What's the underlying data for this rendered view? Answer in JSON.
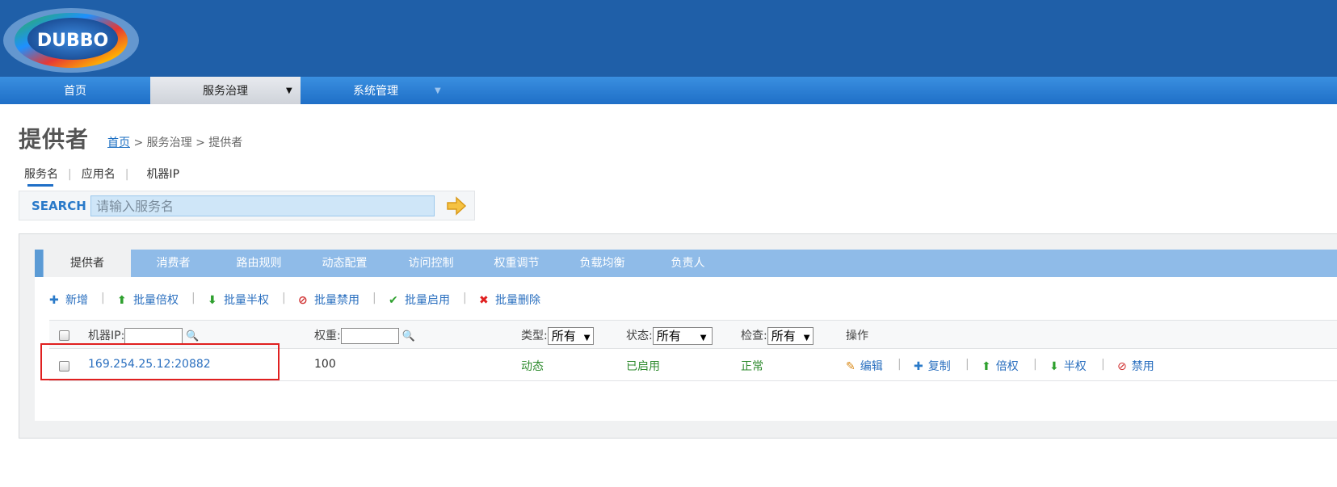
{
  "logo": {
    "text": "DUBBO"
  },
  "nav": {
    "items": [
      {
        "label": "首页"
      },
      {
        "label": "服务治理",
        "arrow": "▼"
      },
      {
        "label": "系统管理",
        "arrow": "▼"
      }
    ]
  },
  "page": {
    "title": "提供者",
    "breadcrumb": {
      "home": "首页",
      "rest": " > 服务治理 > 提供者"
    }
  },
  "search": {
    "tabs": [
      "服务名",
      "应用名",
      "机器IP"
    ],
    "separator": "|",
    "label": "SEARCH",
    "placeholder": "请输入服务名"
  },
  "tabs": [
    "提供者",
    "消费者",
    "路由规则",
    "动态配置",
    "访问控制",
    "权重调节",
    "负载均衡",
    "负责人"
  ],
  "actions": [
    {
      "label": "新增",
      "icon": "plus-icon"
    },
    {
      "label": "批量倍权",
      "icon": "arrow-up-icon"
    },
    {
      "label": "批量半权",
      "icon": "arrow-down-icon"
    },
    {
      "label": "批量禁用",
      "icon": "ban-icon"
    },
    {
      "label": "批量启用",
      "icon": "check-icon"
    },
    {
      "label": "批量删除",
      "icon": "delete-icon"
    }
  ],
  "table": {
    "headers": {
      "ip": "机器IP:",
      "weight": "权重:",
      "type": "类型:",
      "status": "状态:",
      "check": "检查:",
      "ops": "操作"
    },
    "filters": {
      "type": "所有",
      "status": "所有",
      "check": "所有"
    },
    "rows": [
      {
        "ip": "169.254.25.12:20882",
        "weight": "100",
        "type": "动态",
        "status": "已启用",
        "check": "正常",
        "ops": [
          {
            "label": "编辑",
            "icon": "edit-icon"
          },
          {
            "label": "复制",
            "icon": "plus-icon"
          },
          {
            "label": "倍权",
            "icon": "arrow-up-icon"
          },
          {
            "label": "半权",
            "icon": "arrow-down-icon"
          },
          {
            "label": "禁用",
            "icon": "ban-icon"
          }
        ]
      }
    ]
  },
  "colors": {
    "header": "#1f5fa8",
    "link": "#2a6fbf",
    "status_ok": "#2e8b2e",
    "highlight": "#e02020"
  }
}
